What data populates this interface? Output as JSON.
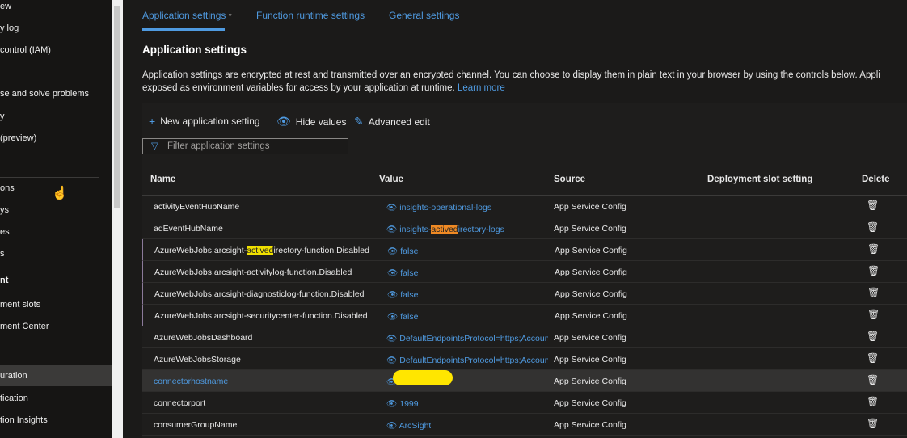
{
  "sidebar": {
    "items": [
      {
        "label": "ew"
      },
      {
        "label": "y log"
      },
      {
        "label": "control (IAM)"
      },
      {
        "label": "se and solve problems"
      },
      {
        "label": "y"
      },
      {
        "label": "(preview)"
      },
      {
        "label": "ons"
      },
      {
        "label": "ys"
      },
      {
        "label": "es"
      },
      {
        "label": "s"
      },
      {
        "label": "nt"
      },
      {
        "label": "ment slots"
      },
      {
        "label": "ment Center"
      },
      {
        "label": "uration",
        "selected": true
      },
      {
        "label": "tication"
      },
      {
        "label": "tion Insights"
      }
    ]
  },
  "tabs": [
    {
      "label": "Application settings",
      "active": true,
      "modified_marker": "*"
    },
    {
      "label": "Function runtime settings"
    },
    {
      "label": "General settings"
    }
  ],
  "section": {
    "title": "Application settings",
    "desc1": "Application settings are encrypted at rest and transmitted over an encrypted channel. You can choose to display them in plain text in your browser by using the controls below. Appli",
    "desc2": "exposed as environment variables for access by your application at runtime.",
    "learn_more": "Learn more"
  },
  "toolbar": {
    "new": "New application setting",
    "hide": "Hide values",
    "advanced": "Advanced edit"
  },
  "filter": {
    "placeholder": "Filter application settings"
  },
  "columns": {
    "name": "Name",
    "value": "Value",
    "source": "Source",
    "slot": "Deployment slot setting",
    "delete": "Delete"
  },
  "rows": [
    {
      "name": "activityEventHubName",
      "value": "insights-operational-logs",
      "source": "App Service Config"
    },
    {
      "name": "adEventHubName",
      "value_pre": "insights-",
      "value_hl": "actived",
      "value_post": "irectory-logs",
      "source": "App Service Config"
    },
    {
      "name_pre": "AzureWebJobs.arcsight-",
      "name_hl": "actived",
      "name_post": "irectory-function.Disabled",
      "value": "false",
      "source": "App Service Config"
    },
    {
      "name": "AzureWebJobs.arcsight-activitylog-function.Disabled",
      "value": "false",
      "source": "App Service Config"
    },
    {
      "name": "AzureWebJobs.arcsight-diagnosticlog-function.Disabled",
      "value": "false",
      "source": "App Service Config"
    },
    {
      "name": "AzureWebJobs.arcsight-securitycenter-function.Disabled",
      "value": "false",
      "source": "App Service Config"
    },
    {
      "name": "AzureWebJobsDashboard",
      "value": "DefaultEndpointsProtocol=https;Accoun",
      "source": "App Service Config"
    },
    {
      "name": "AzureWebJobsStorage",
      "value": "DefaultEndpointsProtocol=https;Accoun",
      "source": "App Service Config"
    },
    {
      "name": "connectorhostname",
      "value": "",
      "source": "App Service Config",
      "selected": true,
      "redacted": true
    },
    {
      "name": "connectorport",
      "value": "1999",
      "source": "App Service Config"
    },
    {
      "name": "consumerGroupName",
      "value": "ArcSight",
      "source": "App Service Config"
    }
  ]
}
